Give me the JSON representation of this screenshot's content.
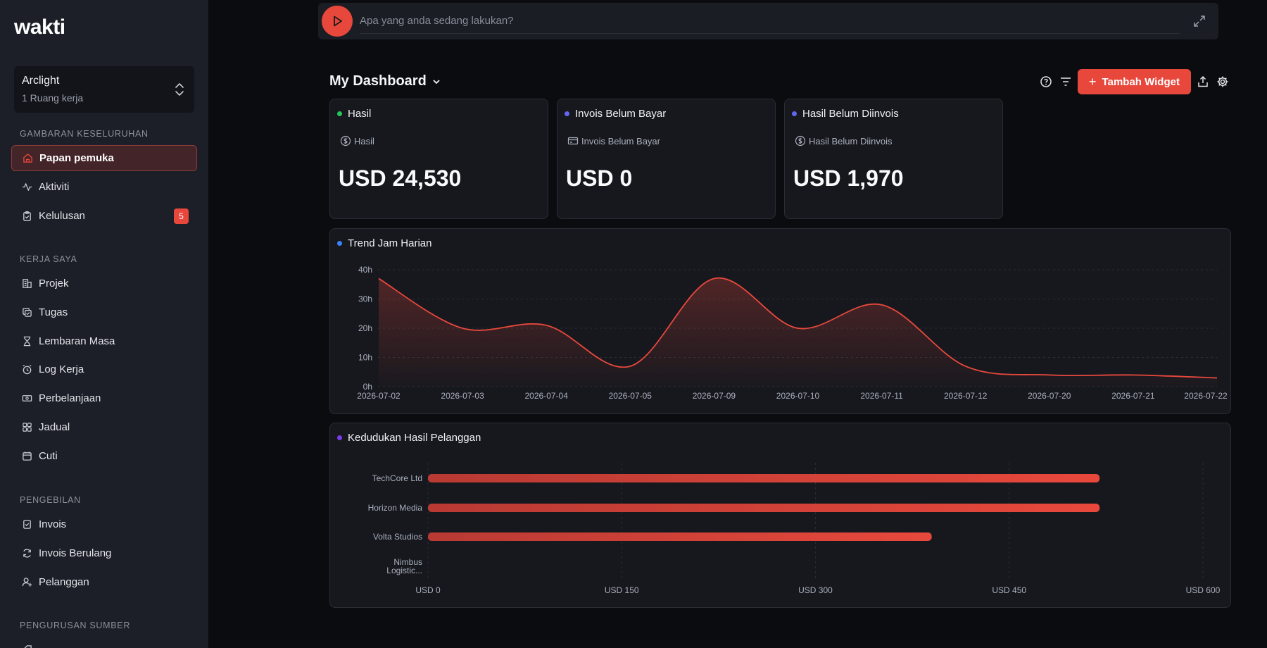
{
  "app": {
    "logo_text": "wakti"
  },
  "workspace": {
    "name": "Arclight",
    "subtitle": "1 Ruang kerja"
  },
  "sidebar": {
    "sections": [
      {
        "label": "GAMBARAN KESELURUHAN"
      },
      {
        "label": "KERJA SAYA"
      },
      {
        "label": "PENGEBILAN"
      },
      {
        "label": "PENGURUSAN SUMBER"
      }
    ],
    "items": [
      {
        "label": "Papan pemuka",
        "icon": "home-icon",
        "active": true
      },
      {
        "label": "Aktiviti",
        "icon": "activity-icon"
      },
      {
        "label": "Kelulusan",
        "icon": "clipboard-check-icon",
        "badge": "5"
      },
      {
        "label": "Projek",
        "icon": "building-icon"
      },
      {
        "label": "Tugas",
        "icon": "tasks-icon"
      },
      {
        "label": "Lembaran Masa",
        "icon": "hourglass-icon"
      },
      {
        "label": "Log Kerja",
        "icon": "alarm-clock-icon"
      },
      {
        "label": "Perbelanjaan",
        "icon": "banknote-icon"
      },
      {
        "label": "Jadual",
        "icon": "grid-icon"
      },
      {
        "label": "Cuti",
        "icon": "calendar-icon"
      },
      {
        "label": "Invois",
        "icon": "invoice-icon"
      },
      {
        "label": "Invois Berulang",
        "icon": "refresh-icon"
      },
      {
        "label": "Pelanggan",
        "icon": "user-plus-icon"
      }
    ]
  },
  "topbar": {
    "placeholder": "Apa yang anda sedang lakukan?"
  },
  "dashboard": {
    "title": "My Dashboard",
    "add_widget_label": "Tambah Widget"
  },
  "stats": [
    {
      "title": "Hasil",
      "subtitle": "Hasil",
      "value": "USD 24,530",
      "dot_color": "#22c55e",
      "icon": "dollar-circle-icon"
    },
    {
      "title": "Invois Belum Bayar",
      "subtitle": "Invois Belum Bayar",
      "value": "USD 0",
      "dot_color": "#6366f1",
      "icon": "credit-card-icon"
    },
    {
      "title": "Hasil Belum Diinvois",
      "subtitle": "Hasil Belum Diinvois",
      "value": "USD 1,970",
      "dot_color": "#6366f1",
      "icon": "dollar-circle-icon"
    }
  ],
  "colors": {
    "accent": "#e8483c",
    "trend_dot": "#3b82f6",
    "ranking_dot": "#7c3aed"
  },
  "chart_data": [
    {
      "type": "area",
      "title": "Trend Jam Harian",
      "x": [
        "2026-07-02",
        "2026-07-03",
        "2026-07-04",
        "2026-07-05",
        "2026-07-09",
        "2026-07-10",
        "2026-07-11",
        "2026-07-12",
        "2026-07-20",
        "2026-07-21",
        "2026-07-22"
      ],
      "values": [
        37,
        20,
        21,
        7,
        37,
        20,
        28,
        7,
        4,
        4,
        3
      ],
      "yticks": [
        "0h",
        "10h",
        "20h",
        "30h",
        "40h"
      ],
      "ylim": [
        0,
        40
      ]
    },
    {
      "type": "bar",
      "orientation": "horizontal",
      "title": "Kedudukan Hasil Pelanggan",
      "categories": [
        "TechCore Ltd",
        "Horizon Media",
        "Volta Studios",
        "Nimbus Logistic..."
      ],
      "values": [
        520,
        520,
        390,
        0
      ],
      "xticks": [
        "USD 0",
        "USD 150",
        "USD 300",
        "USD 450",
        "USD 600"
      ],
      "xlim": [
        0,
        600
      ]
    }
  ]
}
